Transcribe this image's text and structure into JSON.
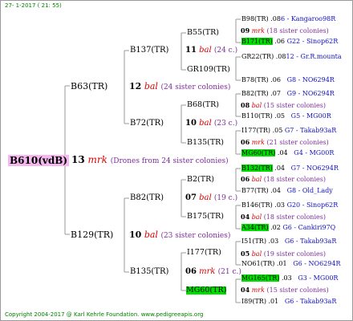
{
  "header_date": "27- 1-2017 ( 21: 55)",
  "footer": "Copyright 2004-2017 @ Karl Kehrle Foundation.   www.pedigreeapis.org",
  "root": {
    "name": "B610(vdB)",
    "num": "13",
    "mark": "mrk",
    "desc": "(Drones from 24 sister colonies)"
  },
  "gen1": [
    {
      "name": "B63(TR)",
      "num": "12",
      "mark": "bal",
      "desc": "(24 sister colonies)"
    },
    {
      "name": "B129(TR)",
      "num": "10",
      "mark": "bal",
      "desc": "(23 sister colonies)"
    }
  ],
  "gen2": [
    {
      "name": "B137(TR)",
      "num": "11",
      "mark": "bal",
      "desc": "(24 c.)"
    },
    {
      "name": "B72(TR)",
      "num": "10",
      "mark": "bal",
      "desc": "(23 c.)"
    },
    {
      "name": "B82(TR)",
      "num": "07",
      "mark": "bal",
      "desc": "(19 c.)"
    },
    {
      "name": "B135(TR)",
      "num": "06",
      "mark": "mrk",
      "desc": "(21 c.)"
    }
  ],
  "gen3": [
    {
      "name": "B55(TR)",
      "num": "09",
      "mark": "mrk",
      "desc": "(18 sister colonies)"
    },
    {
      "name": "GR109(TR)",
      "num": "",
      "mark": "",
      "desc": ""
    },
    {
      "name": "B68(TR)",
      "num": "08",
      "mark": "bal",
      "desc": "(15 sister colonies)"
    },
    {
      "name": "B135(TR)",
      "num": "06",
      "mark": "mrk",
      "desc": "(21 sister colonies)"
    },
    {
      "name": "B2(TR)",
      "num": "06",
      "mark": "bal",
      "desc": "(18 sister colonies)"
    },
    {
      "name": "B175(TR)",
      "num": "04",
      "mark": "bal",
      "desc": "(18 sister colonies)"
    },
    {
      "name": "I177(TR)",
      "num": "05",
      "mark": "bal",
      "desc": "(19 sister colonies)"
    },
    {
      "name": "MG60(TR)",
      "num": "04",
      "mark": "mrk",
      "desc": "(15 sister colonies)"
    }
  ],
  "gen4": [
    {
      "name": "B98(TR)",
      "year": ".08",
      "ref": "6 - Kangaroo98R"
    },
    {
      "name": "B171(TR)",
      "year": ".06",
      "ref": "G22 - Sinop62R"
    },
    {
      "name": "GR22(TR)",
      "year": ".08",
      "ref": "12 - Gr.R.mounta"
    },
    {
      "name": "B78(TR)",
      "year": ".06",
      "ref": "G8 - NO6294R"
    },
    {
      "name": "B82(TR)",
      "year": ".07",
      "ref": "G9 - NO6294R"
    },
    {
      "name": "B110(TR)",
      "year": ".05",
      "ref": "G5 - MG00R"
    },
    {
      "name": "I177(TR)",
      "year": ".05",
      "ref": "G7 - Takab93aR"
    },
    {
      "name": "MG60(TR)",
      "year": ".04",
      "ref": "G4 - MG00R"
    },
    {
      "name": "B132(TR)",
      "year": ".04",
      "ref": "G7 - NO6294R"
    },
    {
      "name": "B77(TR)",
      "year": ".04",
      "ref": "G8 - Old_Lady"
    },
    {
      "name": "B146(TR)",
      "year": ".03",
      "ref": "G20 - Sinop62R"
    },
    {
      "name": "A34(TR)",
      "year": ".02",
      "ref": "G6 - Cankiri97Q"
    },
    {
      "name": "I51(TR)",
      "year": ".03",
      "ref": "G6 - Takab93aR"
    },
    {
      "name": "NO61(TR)",
      "year": ".01",
      "ref": "G6 - NO6294R"
    },
    {
      "name": "MG165(TR)",
      "year": ".03",
      "ref": "G3 - MG00R"
    },
    {
      "name": "I89(TR)",
      "year": ".01",
      "ref": "G6 - Takab93aR"
    }
  ]
}
